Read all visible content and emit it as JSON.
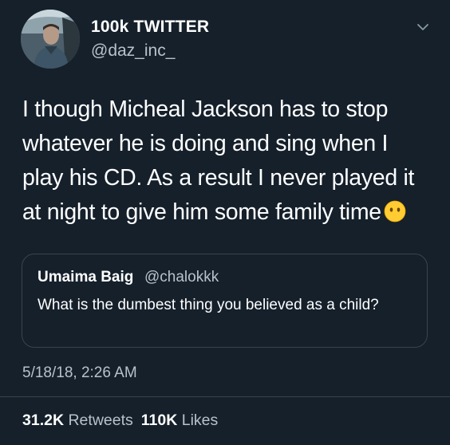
{
  "header": {
    "display_name": "100k TWITTER",
    "handle": "@daz_inc_"
  },
  "tweet": {
    "lines": [
      "I though Micheal Jackson has to stop",
      "whatever he is doing and sing when I",
      "play his CD. As a result I never played it",
      "at night to give him some family time"
    ],
    "emoji": "face-without-mouth-icon"
  },
  "quoted_tweet": {
    "name": "Umaima Baig",
    "handle": "@chalokkk",
    "text": "What is the dumbest thing you believed as a child?"
  },
  "meta": {
    "timestamp": "5/18/18, 2:26 AM"
  },
  "stats": {
    "retweets_count": "31.2K",
    "retweets_label": "Retweets",
    "likes_count": "110K",
    "likes_label": "Likes"
  },
  "colors": {
    "background": "#15202b",
    "secondary_text": "#b7c2cc",
    "border": "#38444d"
  }
}
